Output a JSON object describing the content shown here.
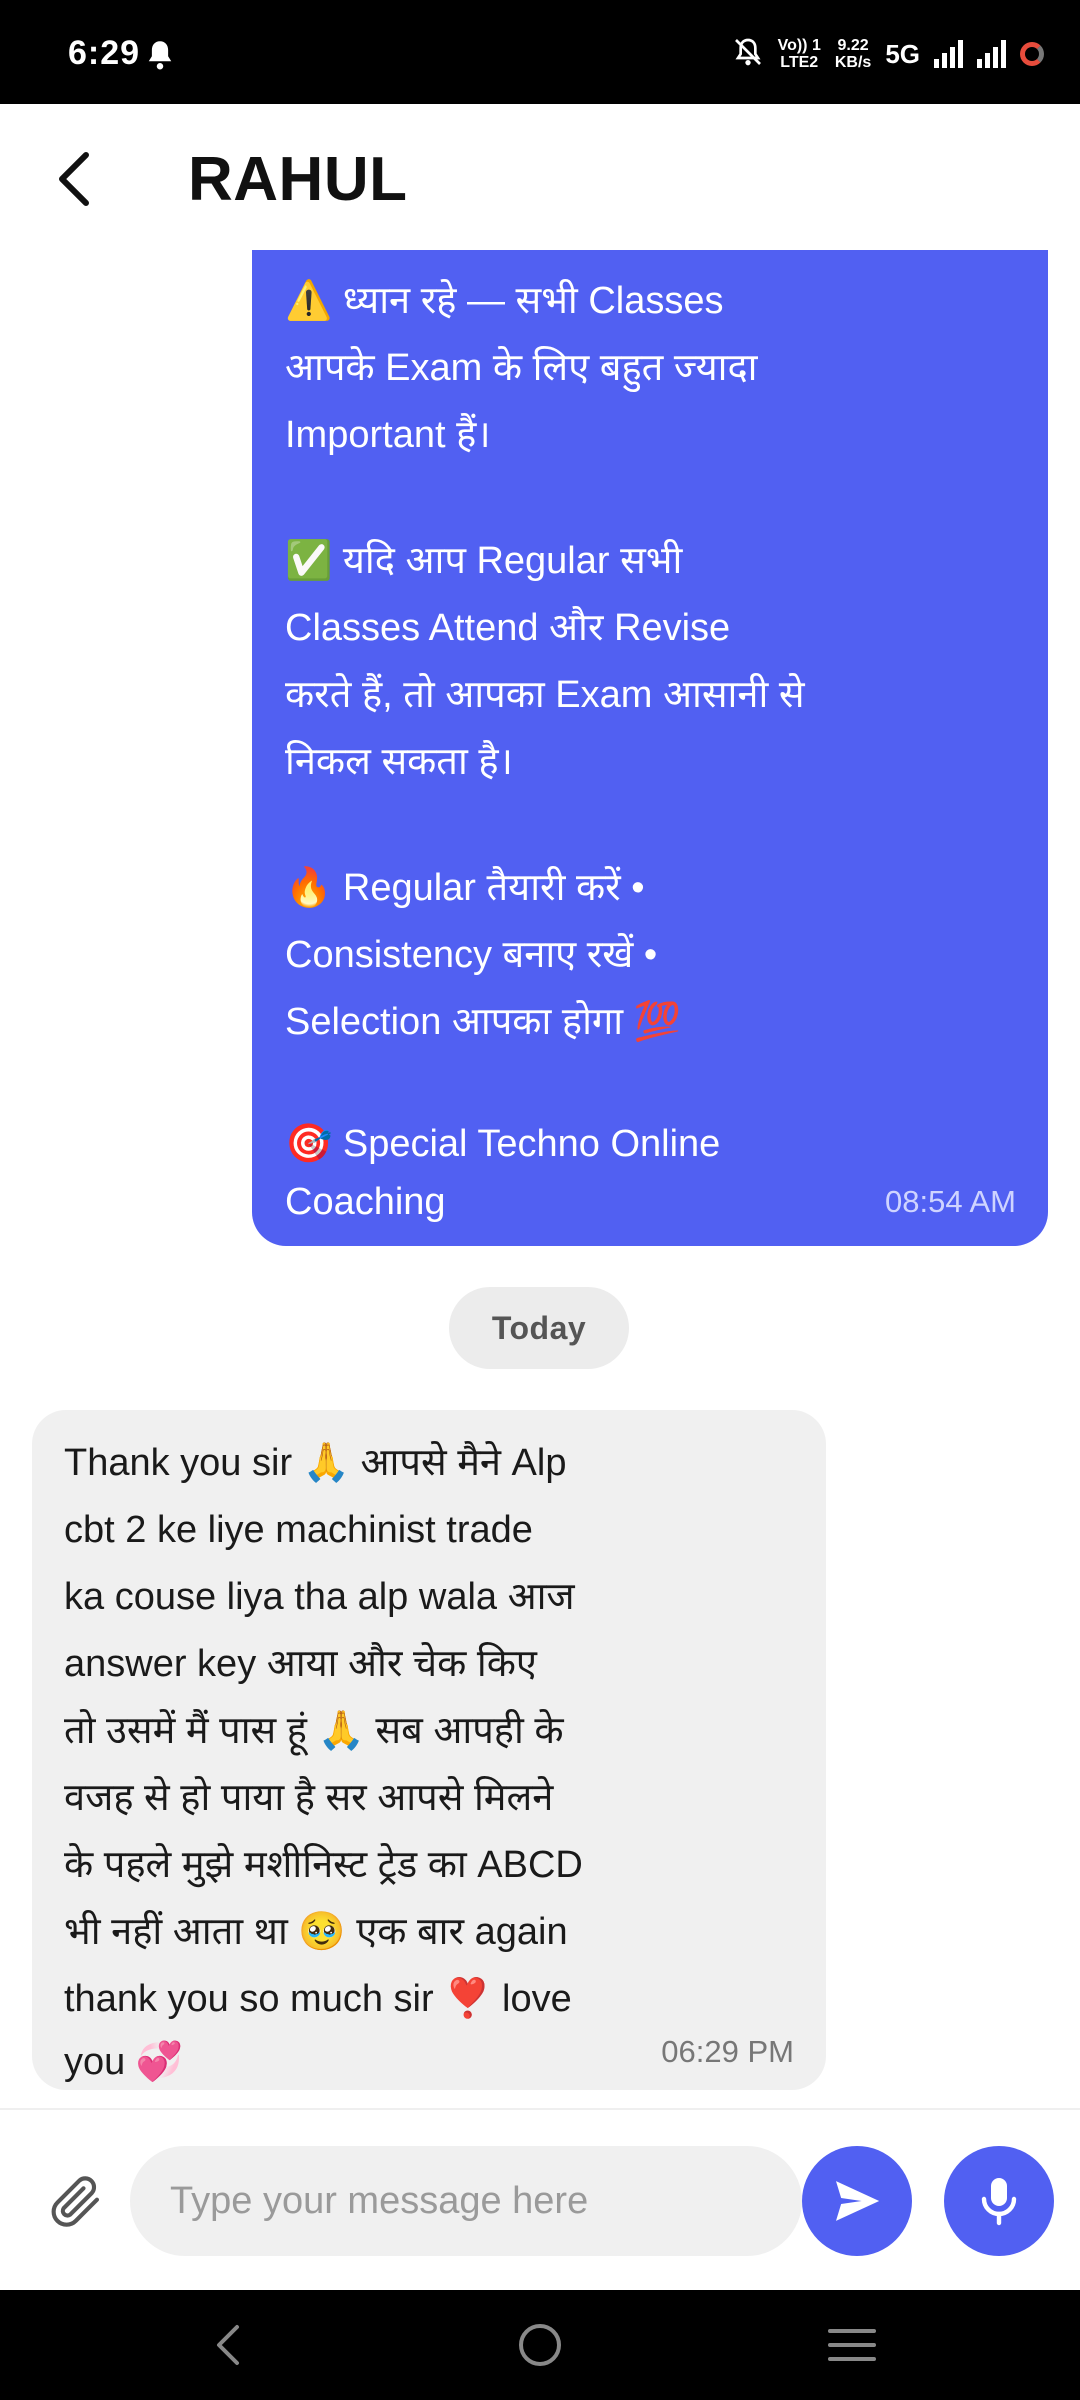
{
  "status_bar": {
    "time": "6:29",
    "volte_top": "Vo)) 1",
    "volte_bottom": "LTE2",
    "speed_top": "9.22",
    "speed_bottom": "KB/s",
    "network": "5G",
    "icons": [
      "bell-icon",
      "mute-icon",
      "signal-icon",
      "signal-icon",
      "battery-icon"
    ]
  },
  "header": {
    "title": "RAHUL",
    "back_icon": "chevron-left-icon"
  },
  "messages": {
    "outgoing": {
      "paragraphs": [
        [
          "⚠️ ध्यान रहे — सभी Classes",
          "आपके Exam के लिए बहुत ज्यादा",
          "Important हैं।"
        ],
        [
          "✅ यदि आप Regular सभी",
          "Classes Attend और Revise",
          "करते हैं, तो आपका Exam आसानी से",
          "निकल सकता है।"
        ],
        [
          "🔥 Regular तैयारी करें •",
          "Consistency बनाए रखें •",
          "Selection आपका होगा 💯"
        ],
        [
          "🎯 Special Techno Online",
          "Coaching"
        ]
      ],
      "time": "08:54 AM"
    },
    "date_separator": "Today",
    "incoming": {
      "lines": [
        "Thank you sir 🙏 आपसे मैने Alp",
        "cbt 2 ke liye machinist trade",
        "ka couse liya tha alp wala आज",
        "answer key आया और चेक किए",
        "तो उसमें मैं पास हूं 🙏 सब आपही के",
        "वजह से हो पाया है सर आपसे मिलने",
        "के पहले मुझे मशीनिस्ट ट्रेड का ABCD",
        "भी नहीं आता था 🥹 एक बार again",
        "thank you so much sir ❣️ love",
        "you 💞"
      ],
      "time": "06:29 PM"
    }
  },
  "composer": {
    "placeholder": "Type your message here",
    "attach_icon": "paperclip-icon",
    "send_icon": "send-icon",
    "mic_icon": "microphone-icon"
  },
  "nav": {
    "icons": [
      "back-icon",
      "home-icon",
      "recents-icon"
    ]
  },
  "colors": {
    "accent": "#5160f2",
    "incoming_bubble": "#f0f0f0",
    "status_bar": "#000000"
  }
}
